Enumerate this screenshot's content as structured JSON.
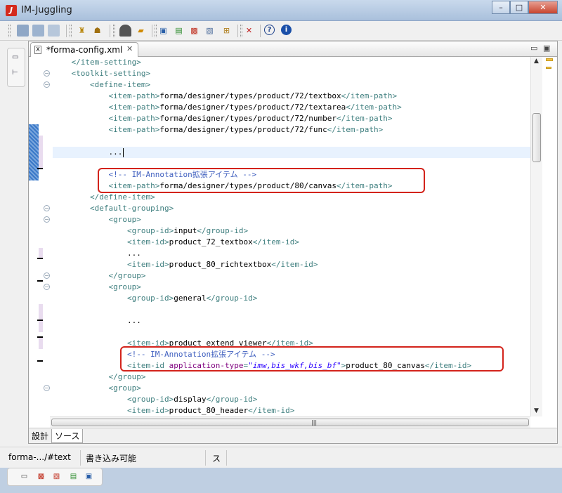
{
  "window": {
    "title": "IM-Juggling"
  },
  "toolbar": {
    "icons": [
      "save-icon",
      "save-as-icon",
      "save-all-icon",
      "deploy-icon",
      "properties-icon",
      "helmet-icon",
      "open-folder-icon",
      "monitor-icon",
      "add-server-icon",
      "image-icon",
      "image-edit-icon",
      "tree-icon",
      "tools-icon",
      "help-icon",
      "info-icon"
    ]
  },
  "editor": {
    "tab_label": "*forma-config.xml",
    "lines": [
      {
        "indent": "    ",
        "parts": [
          {
            "t": "tag",
            "v": "</item-setting>"
          }
        ]
      },
      {
        "indent": "    ",
        "parts": [
          {
            "t": "tag",
            "v": "<toolkit-setting>"
          }
        ]
      },
      {
        "indent": "        ",
        "parts": [
          {
            "t": "tag",
            "v": "<define-item>"
          }
        ]
      },
      {
        "indent": "            ",
        "parts": [
          {
            "t": "tag",
            "v": "<item-path>"
          },
          {
            "t": "txt",
            "v": "forma/designer/types/product/72/textbox"
          },
          {
            "t": "tag",
            "v": "</item-path>"
          }
        ]
      },
      {
        "indent": "            ",
        "parts": [
          {
            "t": "tag",
            "v": "<item-path>"
          },
          {
            "t": "txt",
            "v": "forma/designer/types/product/72/textarea"
          },
          {
            "t": "tag",
            "v": "</item-path>"
          }
        ]
      },
      {
        "indent": "            ",
        "parts": [
          {
            "t": "tag",
            "v": "<item-path>"
          },
          {
            "t": "txt",
            "v": "forma/designer/types/product/72/number"
          },
          {
            "t": "tag",
            "v": "</item-path>"
          }
        ]
      },
      {
        "indent": "            ",
        "parts": [
          {
            "t": "tag",
            "v": "<item-path>"
          },
          {
            "t": "txt",
            "v": "forma/designer/types/product/72/func"
          },
          {
            "t": "tag",
            "v": "</item-path>"
          }
        ]
      },
      {
        "indent": "",
        "parts": []
      },
      {
        "indent": "            ",
        "parts": [
          {
            "t": "txt",
            "v": "..."
          }
        ],
        "current": true
      },
      {
        "indent": "",
        "parts": []
      },
      {
        "indent": "            ",
        "parts": [
          {
            "t": "cmt",
            "v": "<!-- IM-Annotation拡張アイテム -->"
          }
        ]
      },
      {
        "indent": "            ",
        "parts": [
          {
            "t": "tag",
            "v": "<item-path>"
          },
          {
            "t": "txt",
            "v": "forma/designer/types/product/80/canvas"
          },
          {
            "t": "tag",
            "v": "</item-path>"
          }
        ]
      },
      {
        "indent": "        ",
        "parts": [
          {
            "t": "tag",
            "v": "</define-item>"
          }
        ]
      },
      {
        "indent": "        ",
        "parts": [
          {
            "t": "tag",
            "v": "<default-grouping>"
          }
        ]
      },
      {
        "indent": "            ",
        "parts": [
          {
            "t": "tag",
            "v": "<group>"
          }
        ]
      },
      {
        "indent": "                ",
        "parts": [
          {
            "t": "tag",
            "v": "<group-id>"
          },
          {
            "t": "txt",
            "v": "input"
          },
          {
            "t": "tag",
            "v": "</group-id>"
          }
        ]
      },
      {
        "indent": "                ",
        "parts": [
          {
            "t": "tag",
            "v": "<item-id>"
          },
          {
            "t": "txt",
            "v": "product_72_textbox"
          },
          {
            "t": "tag",
            "v": "</item-id>"
          }
        ]
      },
      {
        "indent": "                ",
        "parts": [
          {
            "t": "txt",
            "v": "..."
          }
        ]
      },
      {
        "indent": "                ",
        "parts": [
          {
            "t": "tag",
            "v": "<item-id>"
          },
          {
            "t": "txt",
            "v": "product_80_richtextbox"
          },
          {
            "t": "tag",
            "v": "</item-id>"
          }
        ]
      },
      {
        "indent": "            ",
        "parts": [
          {
            "t": "tag",
            "v": "</group>"
          }
        ]
      },
      {
        "indent": "            ",
        "parts": [
          {
            "t": "tag",
            "v": "<group>"
          }
        ]
      },
      {
        "indent": "                ",
        "parts": [
          {
            "t": "tag",
            "v": "<group-id>"
          },
          {
            "t": "txt",
            "v": "general"
          },
          {
            "t": "tag",
            "v": "</group-id>"
          }
        ]
      },
      {
        "indent": "",
        "parts": []
      },
      {
        "indent": "                ",
        "parts": [
          {
            "t": "txt",
            "v": "..."
          }
        ]
      },
      {
        "indent": "",
        "parts": []
      },
      {
        "indent": "                ",
        "parts": [
          {
            "t": "tag",
            "v": "<item-id>"
          },
          {
            "t": "txt",
            "v": "product_extend_viewer"
          },
          {
            "t": "tag",
            "v": "</item-id>"
          }
        ]
      },
      {
        "indent": "                ",
        "parts": [
          {
            "t": "cmt",
            "v": "<!-- IM-Annotation拡張アイテム -->"
          }
        ]
      },
      {
        "indent": "                ",
        "parts": [
          {
            "t": "tag",
            "v": "<item-id "
          },
          {
            "t": "attr",
            "v": "application-type"
          },
          {
            "t": "tag",
            "v": "="
          },
          {
            "t": "val",
            "v": "\"imw,bis_wkf,bis_bf\""
          },
          {
            "t": "tag",
            "v": ">"
          },
          {
            "t": "txt",
            "v": "product_80_canvas"
          },
          {
            "t": "tag",
            "v": "</item-id>"
          }
        ]
      },
      {
        "indent": "            ",
        "parts": [
          {
            "t": "tag",
            "v": "</group>"
          }
        ]
      },
      {
        "indent": "            ",
        "parts": [
          {
            "t": "tag",
            "v": "<group>"
          }
        ]
      },
      {
        "indent": "                ",
        "parts": [
          {
            "t": "tag",
            "v": "<group-id>"
          },
          {
            "t": "txt",
            "v": "display"
          },
          {
            "t": "tag",
            "v": "</group-id>"
          }
        ]
      },
      {
        "indent": "                ",
        "parts": [
          {
            "t": "tag",
            "v": "<item-id>"
          },
          {
            "t": "txt",
            "v": "product_80_header"
          },
          {
            "t": "tag",
            "v": "</item-id>"
          }
        ]
      }
    ],
    "bottom_tabs": [
      "設計",
      "ソース"
    ]
  },
  "status": {
    "node": "forma-.../#text",
    "mode": "書き込み可能",
    "extra": "ス"
  },
  "colors": {
    "tag": "#3f7f7f",
    "comment": "#3f5fbf",
    "highlight": "#d3231b"
  }
}
